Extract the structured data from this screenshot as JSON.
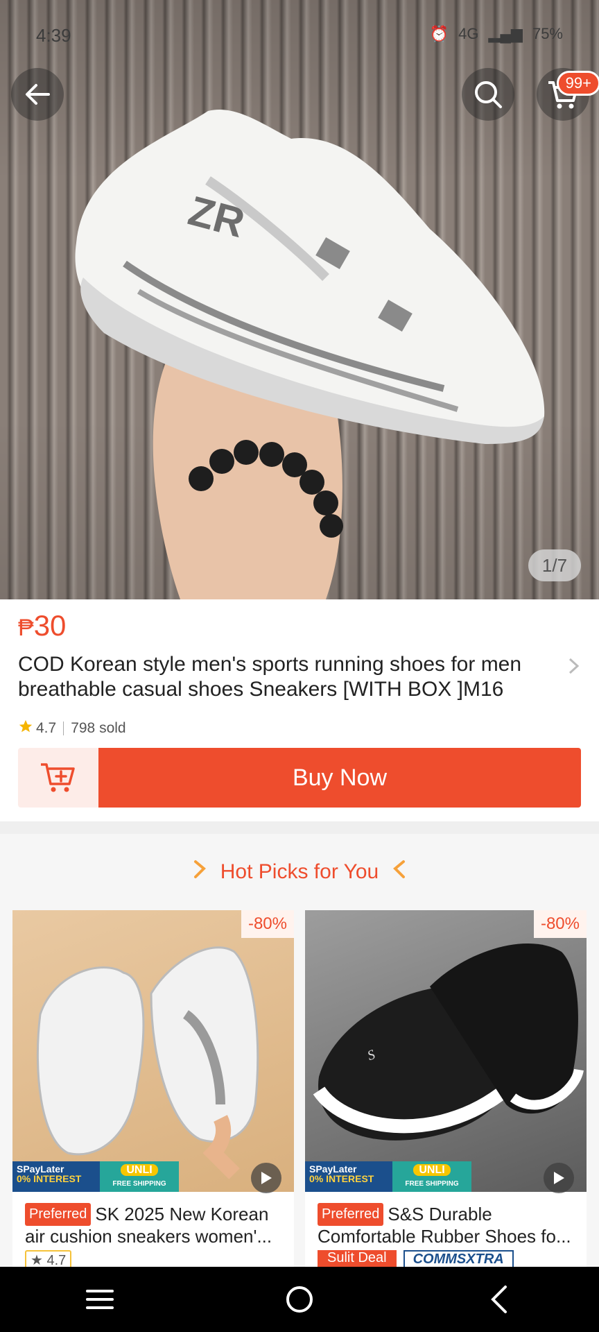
{
  "status_bar": {
    "time": "4:39",
    "network": "4G",
    "battery": "75%"
  },
  "header": {
    "cart_badge": "99+"
  },
  "gallery": {
    "counter": "1/7"
  },
  "product": {
    "currency": "₱",
    "price": "30",
    "title": "COD Korean style men's sports running shoes for men breathable casual shoes Sneakers [WITH BOX ]M16",
    "rating": "4.7",
    "sold": "798 sold"
  },
  "actions": {
    "buy_now": "Buy Now"
  },
  "hot_picks": {
    "title": "Hot Picks for You",
    "items": [
      {
        "discount": "-80%",
        "badge": "Preferred",
        "title_line1": "SK 2025 New Korean",
        "title_line2": "air cushion sneakers women'...",
        "rating": "4.7",
        "promo_spaylater": "SPayLater",
        "promo_interest": "0% INTEREST",
        "promo_unli": "UNLI",
        "promo_shipping": "FREE SHIPPING"
      },
      {
        "discount": "-80%",
        "badge": "Preferred",
        "title_line1": "S&S Durable",
        "title_line2": "Comfortable Rubber Shoes fo...",
        "deal": "Sulit Deal",
        "comms": "COMMSXTRA",
        "promo_spaylater": "SPayLater",
        "promo_interest": "0% INTEREST",
        "promo_unli": "UNLI",
        "promo_shipping": "FREE SHIPPING"
      }
    ]
  },
  "colors": {
    "accent": "#ee4d2d",
    "accent_light": "#fdece8"
  }
}
